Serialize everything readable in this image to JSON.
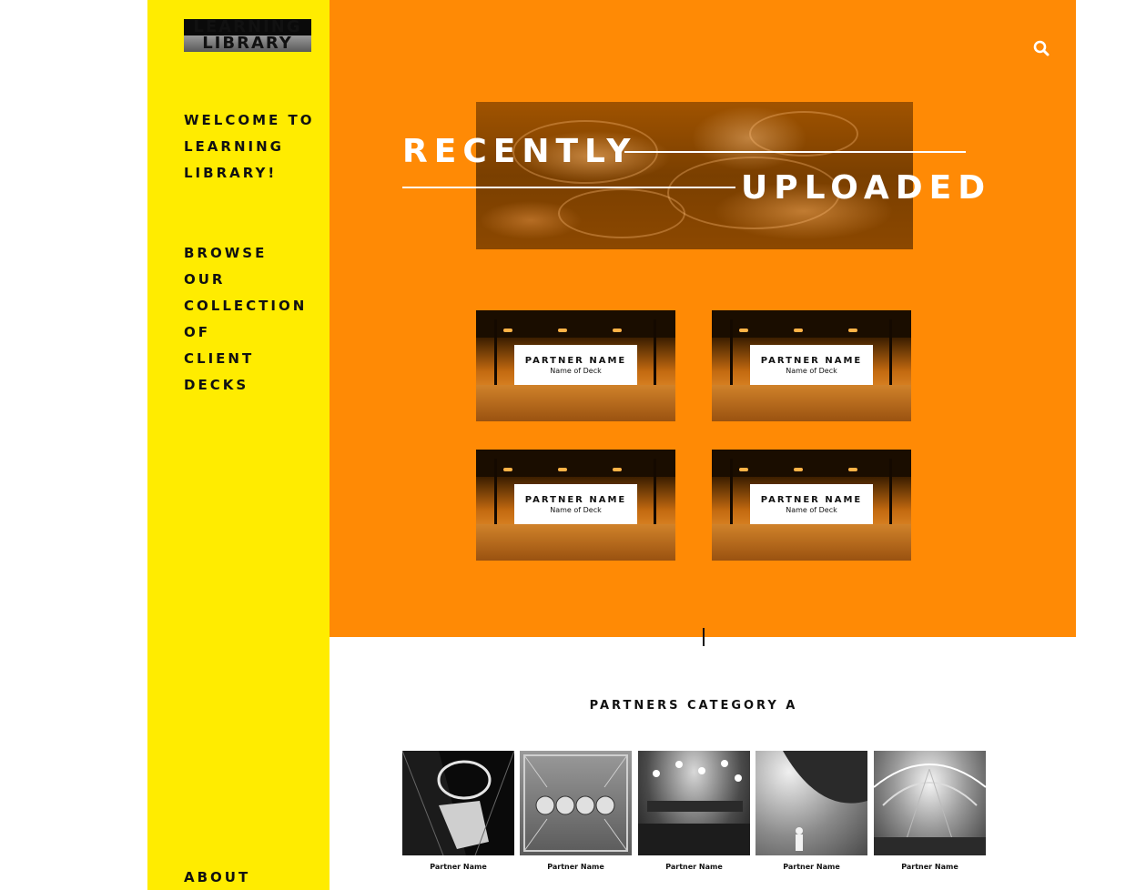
{
  "brand": {
    "line1": "LEARNING",
    "line2": "LIBRARY"
  },
  "sidebar": {
    "welcome": [
      "WELCOME TO",
      "LEARNING",
      "LIBRARY!"
    ],
    "browse": [
      "BROWSE",
      "OUR",
      "COLLECTION",
      "OF",
      "CLIENT",
      "DECKS"
    ],
    "about": "ABOUT"
  },
  "header": {
    "search_icon": "search-icon"
  },
  "hero": {
    "title_word1": "RECENTLY",
    "title_word2": "UPLOADED",
    "cards": [
      {
        "partner": "PARTNER NAME",
        "deck": "Name of Deck"
      },
      {
        "partner": "PARTNER NAME",
        "deck": "Name of Deck"
      },
      {
        "partner": "PARTNER NAME",
        "deck": "Name of Deck"
      },
      {
        "partner": "PARTNER NAME",
        "deck": "Name of Deck"
      }
    ]
  },
  "partners": {
    "category_title": "PARTNERS CATEGORY A",
    "items": [
      {
        "name": "Partner Name"
      },
      {
        "name": "Partner Name"
      },
      {
        "name": "Partner Name"
      },
      {
        "name": "Partner Name"
      },
      {
        "name": "Partner Name"
      }
    ]
  },
  "colors": {
    "sidebar": "#ffec00",
    "hero": "#ff8a05",
    "text": "#111111",
    "white": "#ffffff"
  }
}
